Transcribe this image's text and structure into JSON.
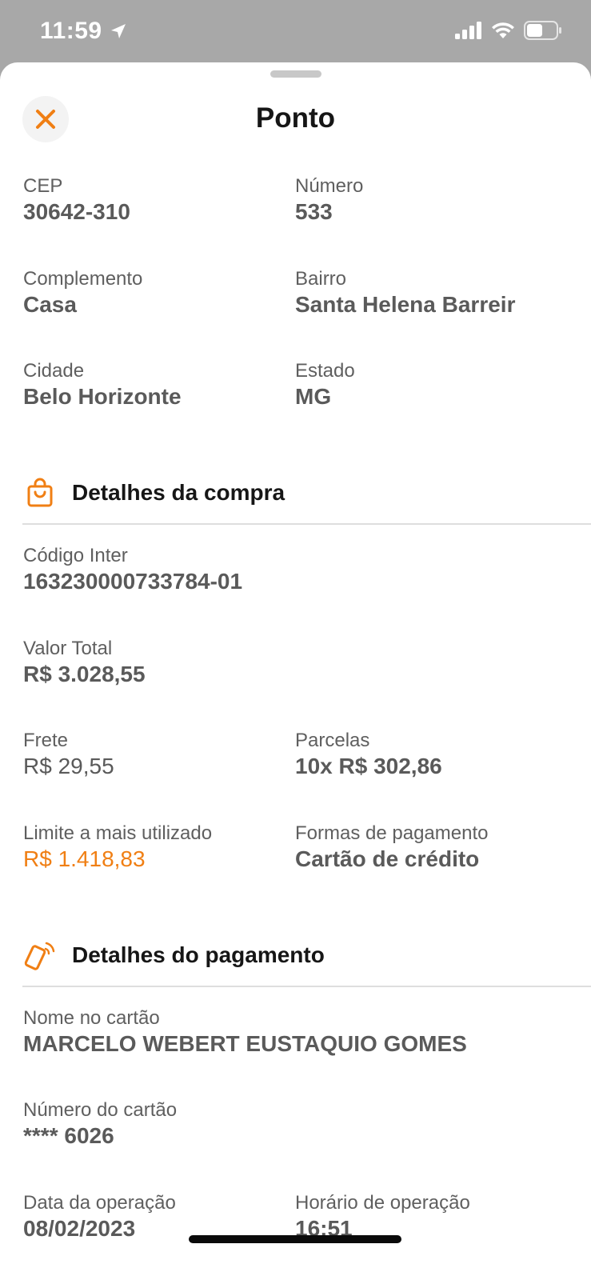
{
  "status_bar": {
    "time": "11:59"
  },
  "header": {
    "title": "Ponto"
  },
  "address": {
    "cep": {
      "label": "CEP",
      "value": "30642-310"
    },
    "numero": {
      "label": "Número",
      "value": "533"
    },
    "complemento": {
      "label": "Complemento",
      "value": "Casa"
    },
    "bairro": {
      "label": "Bairro",
      "value": "Santa Helena Barreir"
    },
    "cidade": {
      "label": "Cidade",
      "value": "Belo Horizonte"
    },
    "estado": {
      "label": "Estado",
      "value": "MG"
    }
  },
  "purchase": {
    "title": "Detalhes da compra",
    "codigo": {
      "label": "Código Inter",
      "value": "163230000733784-01"
    },
    "valor_total": {
      "label": "Valor Total",
      "value": "R$ 3.028,55"
    },
    "frete": {
      "label": "Frete",
      "value": "R$ 29,55"
    },
    "parcelas": {
      "label": "Parcelas",
      "value": "10x R$ 302,86"
    },
    "limite": {
      "label": "Limite a mais utilizado",
      "value": "R$ 1.418,83"
    },
    "formas": {
      "label": "Formas de pagamento",
      "value": "Cartão de crédito"
    }
  },
  "payment": {
    "title": "Detalhes do pagamento",
    "nome": {
      "label": "Nome no cartão",
      "value": "MARCELO WEBERT EUSTAQUIO GOMES"
    },
    "numero_cartao": {
      "label": "Número do cartão",
      "value": "**** 6026"
    },
    "data": {
      "label": "Data da operação",
      "value": "08/02/2023"
    },
    "horario": {
      "label": "Horário de operação",
      "value": "16:51"
    }
  },
  "colors": {
    "accent": "#f07f14",
    "text_dark": "#161616",
    "text_muted": "#5a5a5a",
    "divider": "#dedede"
  },
  "icons": {
    "close": "close-icon",
    "purchase": "shopping-bag-icon",
    "payment": "phone-payment-icon",
    "location": "location-arrow-icon",
    "signal": "cellular-signal-icon",
    "wifi": "wifi-icon",
    "battery": "battery-icon"
  }
}
